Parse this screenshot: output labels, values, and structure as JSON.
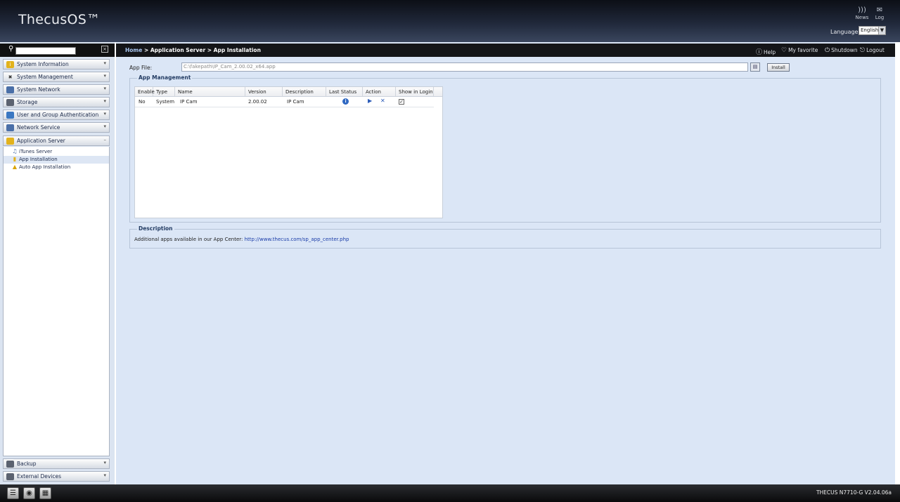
{
  "header": {
    "logo": "ThecusOS™",
    "news_label": "News",
    "log_label": "Log",
    "language_label": "Language:",
    "language_value": "English"
  },
  "sidebar": {
    "search_placeholder": "",
    "menu": [
      {
        "label": "System Information",
        "icon": "info-icon",
        "color": "#e2b21c"
      },
      {
        "label": "System Management",
        "icon": "tools-icon",
        "color": "#6b7382"
      },
      {
        "label": "System Network",
        "icon": "network-icon",
        "color": "#4a6fa8"
      },
      {
        "label": "Storage",
        "icon": "storage-icon",
        "color": "#5b6270"
      },
      {
        "label": "User and Group Authentication",
        "icon": "users-icon",
        "color": "#3b78c2"
      },
      {
        "label": "Network Service",
        "icon": "network-service-icon",
        "color": "#4a6fa8"
      },
      {
        "label": "Application Server",
        "icon": "folder-icon",
        "color": "#e2b21c"
      }
    ],
    "submenu": [
      {
        "label": "iTunes Server",
        "icon": "itunes-icon"
      },
      {
        "label": "App Installation",
        "icon": "app-install-icon"
      },
      {
        "label": "Auto App Installation",
        "icon": "auto-install-icon"
      }
    ],
    "bottom_menu": [
      {
        "label": "Backup",
        "icon": "backup-icon"
      },
      {
        "label": "External Devices",
        "icon": "external-devices-icon"
      }
    ]
  },
  "topbar": {
    "crumb_home": "Home",
    "crumb_rest": " > Application Server > App Installation",
    "help": "Help",
    "favorite": "My favorite",
    "shutdown": "Shutdown",
    "logout": "Logout"
  },
  "appfile": {
    "label": "App File:",
    "value": "C:\\fakepath\\IP_Cam_2.00.02_x64.app",
    "install_label": "Install"
  },
  "app_management": {
    "legend": "App Management",
    "columns": [
      "Enable",
      "Type",
      "Name",
      "Version",
      "Description",
      "Last Status",
      "Action",
      "Show in Login"
    ],
    "rows": [
      {
        "enable": "No",
        "type": "System",
        "name": "IP Cam",
        "version": "2.00.02",
        "description": "IP Cam",
        "show_in_login": true
      }
    ]
  },
  "description": {
    "legend": "Description",
    "text": "Additional apps available in our App Center:",
    "link": "http://www.thecus.com/sp_app_center.php"
  },
  "footer": {
    "version": "THECUS N7710-G V2.04.06a"
  }
}
